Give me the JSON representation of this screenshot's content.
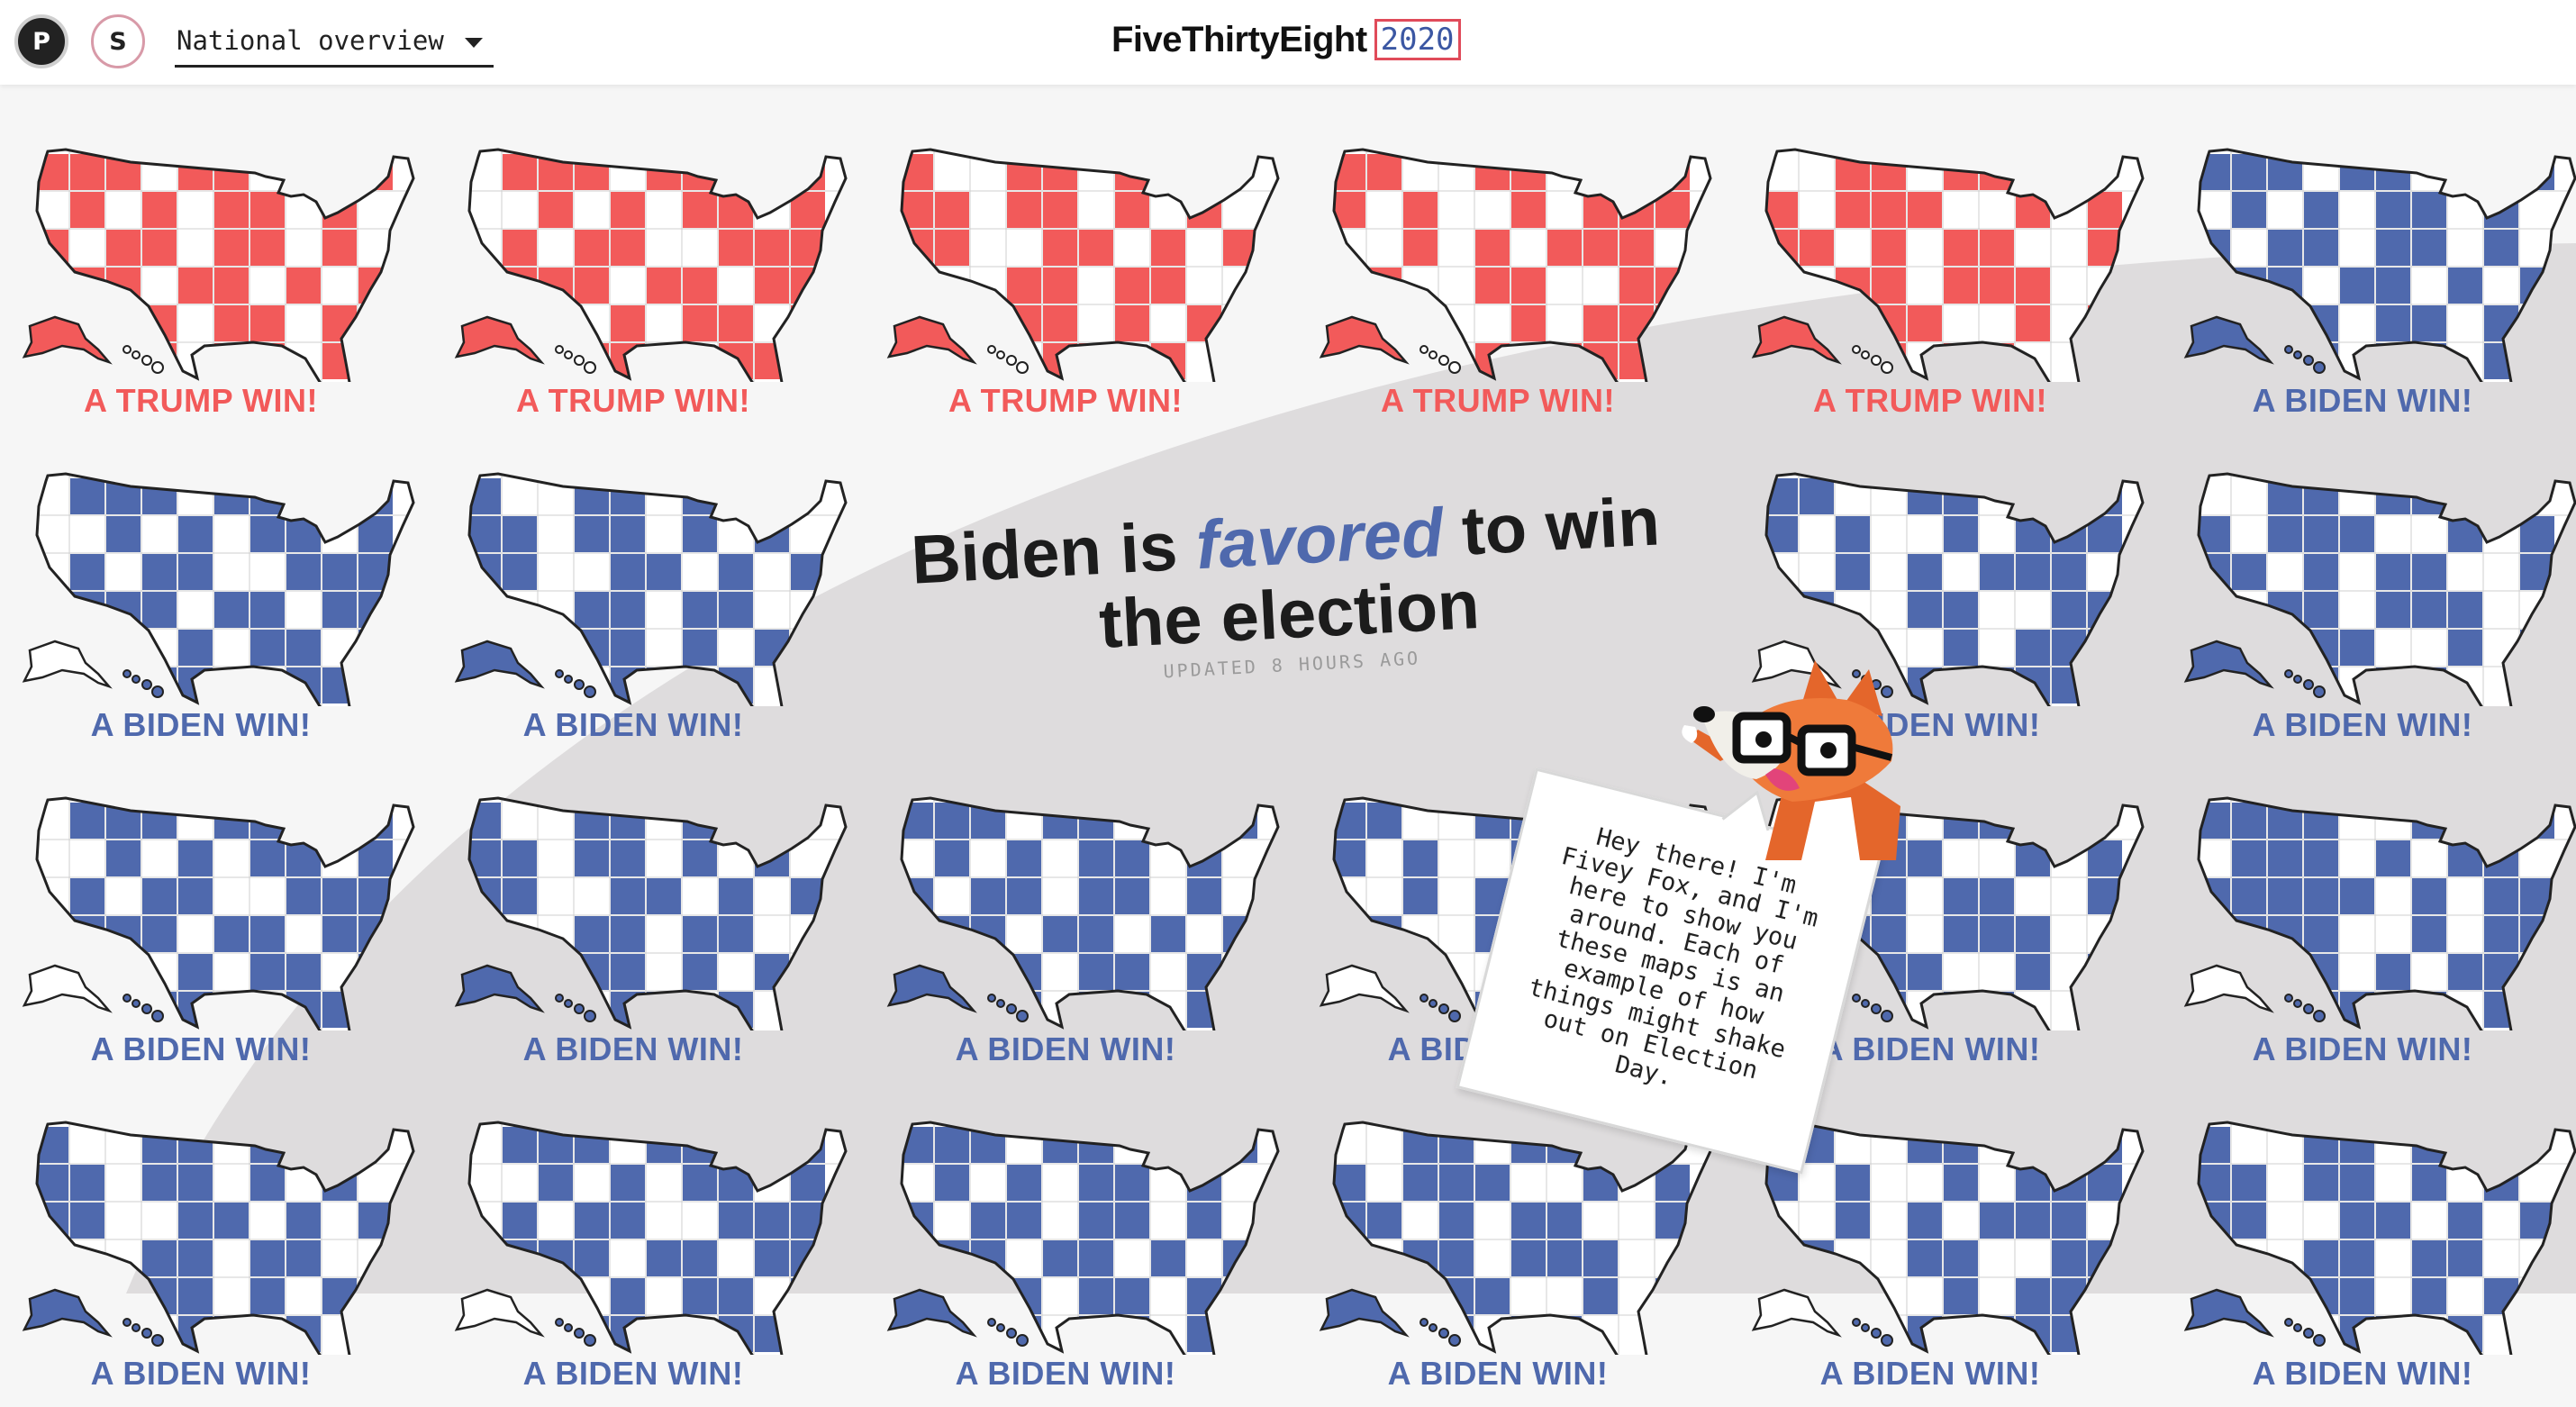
{
  "header": {
    "buttons": [
      {
        "label": "P",
        "name": "polls-only-button"
      },
      {
        "label": "S",
        "name": "senate-button"
      }
    ],
    "view_select": {
      "selected": "National overview"
    },
    "brand": {
      "name": "FiveThirtyEight",
      "year": "2020"
    }
  },
  "headline": {
    "part1": "Biden is ",
    "emphasis": "favored",
    "part2": " to win",
    "line2": "the election",
    "updated": "UPDATED 8 HOURS AGO"
  },
  "fivey": {
    "speech": "Hey there! I'm Fivey Fox, and I'm here to show you around. Each of these maps is an example of how things might shake out on Election Day."
  },
  "colors": {
    "trump": "#f25a5a",
    "biden": "#4f69ad",
    "brand_red": "#e04b5a",
    "brand_blue": "#3b57a3"
  },
  "maps": [
    {
      "label": "A TRUMP WIN!",
      "winner": "trump",
      "pattern": 0
    },
    {
      "label": "A TRUMP WIN!",
      "winner": "trump",
      "pattern": 1
    },
    {
      "label": "A TRUMP WIN!",
      "winner": "trump",
      "pattern": 2
    },
    {
      "label": "A TRUMP WIN!",
      "winner": "trump",
      "pattern": 3
    },
    {
      "label": "A TRUMP WIN!",
      "winner": "trump",
      "pattern": 4
    },
    {
      "label": "A BIDEN WIN!",
      "winner": "biden",
      "pattern": 0
    },
    {
      "label": "A BIDEN WIN!",
      "winner": "biden",
      "pattern": 1
    },
    {
      "label": "A BIDEN WIN!",
      "winner": "biden",
      "pattern": 2
    },
    {
      "label": "A BIDEN WIN!",
      "winner": "biden",
      "pattern": 3
    },
    {
      "label": "A BIDEN WIN!",
      "winner": "biden",
      "pattern": 4
    },
    {
      "label": "A BIDEN WIN!",
      "winner": "biden",
      "pattern": 1
    },
    {
      "label": "A BIDEN WIN!",
      "winner": "biden",
      "pattern": 2
    },
    {
      "label": "A BIDEN WIN!",
      "winner": "biden",
      "pattern": 0
    },
    {
      "label": "A BIDEN WIN!",
      "winner": "biden",
      "pattern": 3
    },
    {
      "label": "A BIDEN WIN!",
      "winner": "biden",
      "pattern": 4
    },
    {
      "label": "A BIDEN WIN!",
      "winner": "biden",
      "pattern": 5
    },
    {
      "label": "A BIDEN WIN!",
      "winner": "biden",
      "pattern": 2
    },
    {
      "label": "A BIDEN WIN!",
      "winner": "biden",
      "pattern": 1
    },
    {
      "label": "A BIDEN WIN!",
      "winner": "biden",
      "pattern": 0
    },
    {
      "label": "A BIDEN WIN!",
      "winner": "biden",
      "pattern": 4
    },
    {
      "label": "A BIDEN WIN!",
      "winner": "biden",
      "pattern": 3
    },
    {
      "label": "A BIDEN WIN!",
      "winner": "biden",
      "pattern": 2
    }
  ]
}
